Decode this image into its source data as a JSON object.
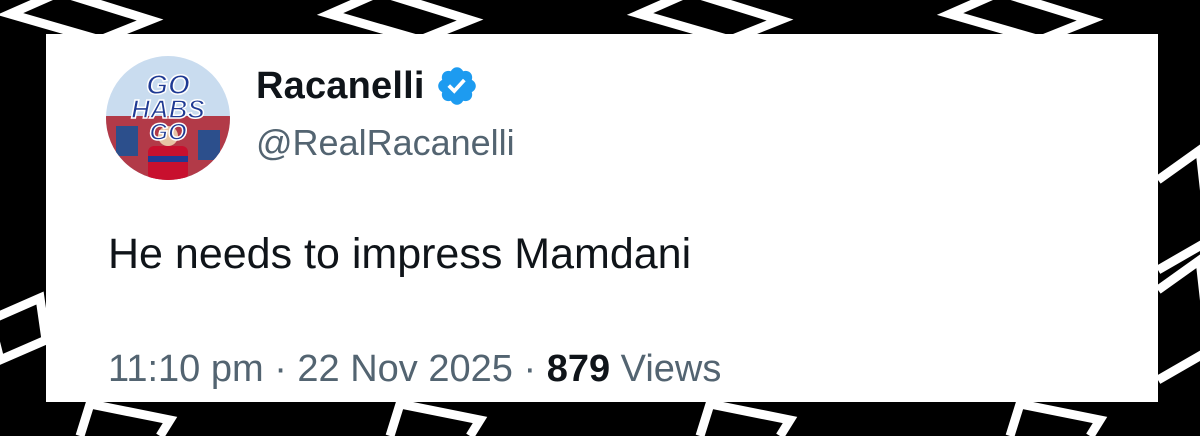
{
  "author": {
    "display_name": "Racanelli",
    "handle": "@RealRacanelli",
    "verified_icon": "verified-badge-icon",
    "avatar_text": [
      "GO",
      "HABS",
      "GO"
    ]
  },
  "tweet": {
    "text": "He needs to impress Mamdani",
    "time": "11:10 pm",
    "separator": "·",
    "date": "22 Nov 2025",
    "views_count": "879",
    "views_label": "Views"
  },
  "colors": {
    "background": "#000000",
    "card": "#ffffff",
    "text_primary": "#0f1419",
    "text_secondary": "#536471",
    "verified": "#1d9bf0"
  }
}
